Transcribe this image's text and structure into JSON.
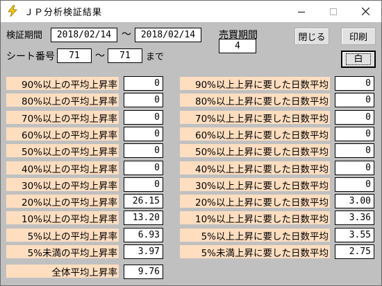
{
  "window": {
    "title": "ＪＰ分析検証結果"
  },
  "header": {
    "period_label": "検証期間",
    "date_from": "2018/02/14",
    "tilde": "～",
    "date_to": "2018/02/14",
    "trade_period_label": "売買期間",
    "trade_period_value": "4",
    "sheet_label": "シート番号",
    "sheet_from": "71",
    "sheet_to": "71",
    "made_label": "まで"
  },
  "buttons": {
    "close": "閉じる",
    "print": "印刷",
    "white": "白"
  },
  "left_stats": [
    {
      "label": "90%以上の平均上昇率",
      "value": "0"
    },
    {
      "label": "80%以上の平均上昇率",
      "value": "0"
    },
    {
      "label": "70%以上の平均上昇率",
      "value": "0"
    },
    {
      "label": "60%以上の平均上昇率",
      "value": "0"
    },
    {
      "label": "50%以上の平均上昇率",
      "value": "0"
    },
    {
      "label": "40%以上の平均上昇率",
      "value": "0"
    },
    {
      "label": "30%以上の平均上昇率",
      "value": "0"
    },
    {
      "label": "20%以上の平均上昇率",
      "value": "26.15"
    },
    {
      "label": "10%以上の平均上昇率",
      "value": "13.20"
    },
    {
      "label": "5%以上の平均上昇率",
      "value": "6.93"
    },
    {
      "label": "5%未満の平均上昇率",
      "value": "3.97"
    }
  ],
  "right_stats": [
    {
      "label": "90%以上上昇に要した日数平均",
      "value": "0"
    },
    {
      "label": "80%以上上昇に要した日数平均",
      "value": "0"
    },
    {
      "label": "70%以上上昇に要した日数平均",
      "value": "0"
    },
    {
      "label": "60%以上上昇に要した日数平均",
      "value": "0"
    },
    {
      "label": "50%以上上昇に要した日数平均",
      "value": "0"
    },
    {
      "label": "40%以上上昇に要した日数平均",
      "value": "0"
    },
    {
      "label": "30%以上上昇に要した日数平均",
      "value": "0"
    },
    {
      "label": "20%以上上昇に要した日数平均",
      "value": "3.00"
    },
    {
      "label": "10%以上上昇に要した日数平均",
      "value": "3.36"
    },
    {
      "label": "5%以上上昇に要した日数平均",
      "value": "3.55"
    },
    {
      "label": "5%未満上昇に要した日数平均",
      "value": "2.75"
    }
  ],
  "total": {
    "label": "全体平均上昇率",
    "value": "9.76"
  },
  "colors": {
    "label_bg": "#ffdec0",
    "window_bg": "#c0c0c0"
  },
  "icons": {
    "app": "lightning-icon",
    "minimize": "minimize-icon",
    "maximize": "maximize-icon",
    "close": "close-icon"
  }
}
